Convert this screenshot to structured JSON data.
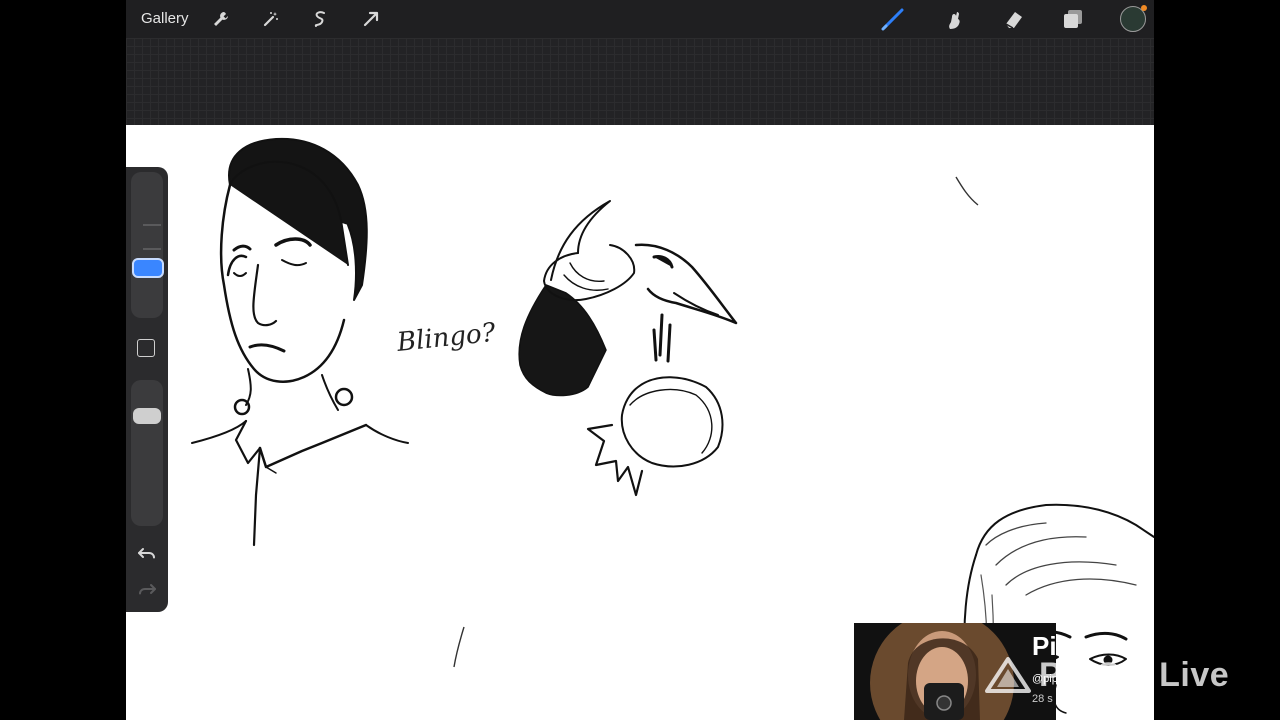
{
  "topbar": {
    "gallery_label": "Gallery",
    "left_tools": [
      "wrench-icon",
      "magic-wand-icon",
      "selection-icon",
      "transform-arrow-icon"
    ],
    "right_tools": [
      "brush-icon",
      "smudge-icon",
      "eraser-icon",
      "layers-icon"
    ],
    "active_tool": "brush-icon",
    "color_swatch": "#2a3a33",
    "accent": "#2d7ff9"
  },
  "canvas": {
    "handwritten_text": "Blingo?"
  },
  "stream_card": {
    "name": "Pi",
    "handle": "@pip",
    "followers": "28 s"
  },
  "watermark": {
    "text": "PRISM Live"
  }
}
